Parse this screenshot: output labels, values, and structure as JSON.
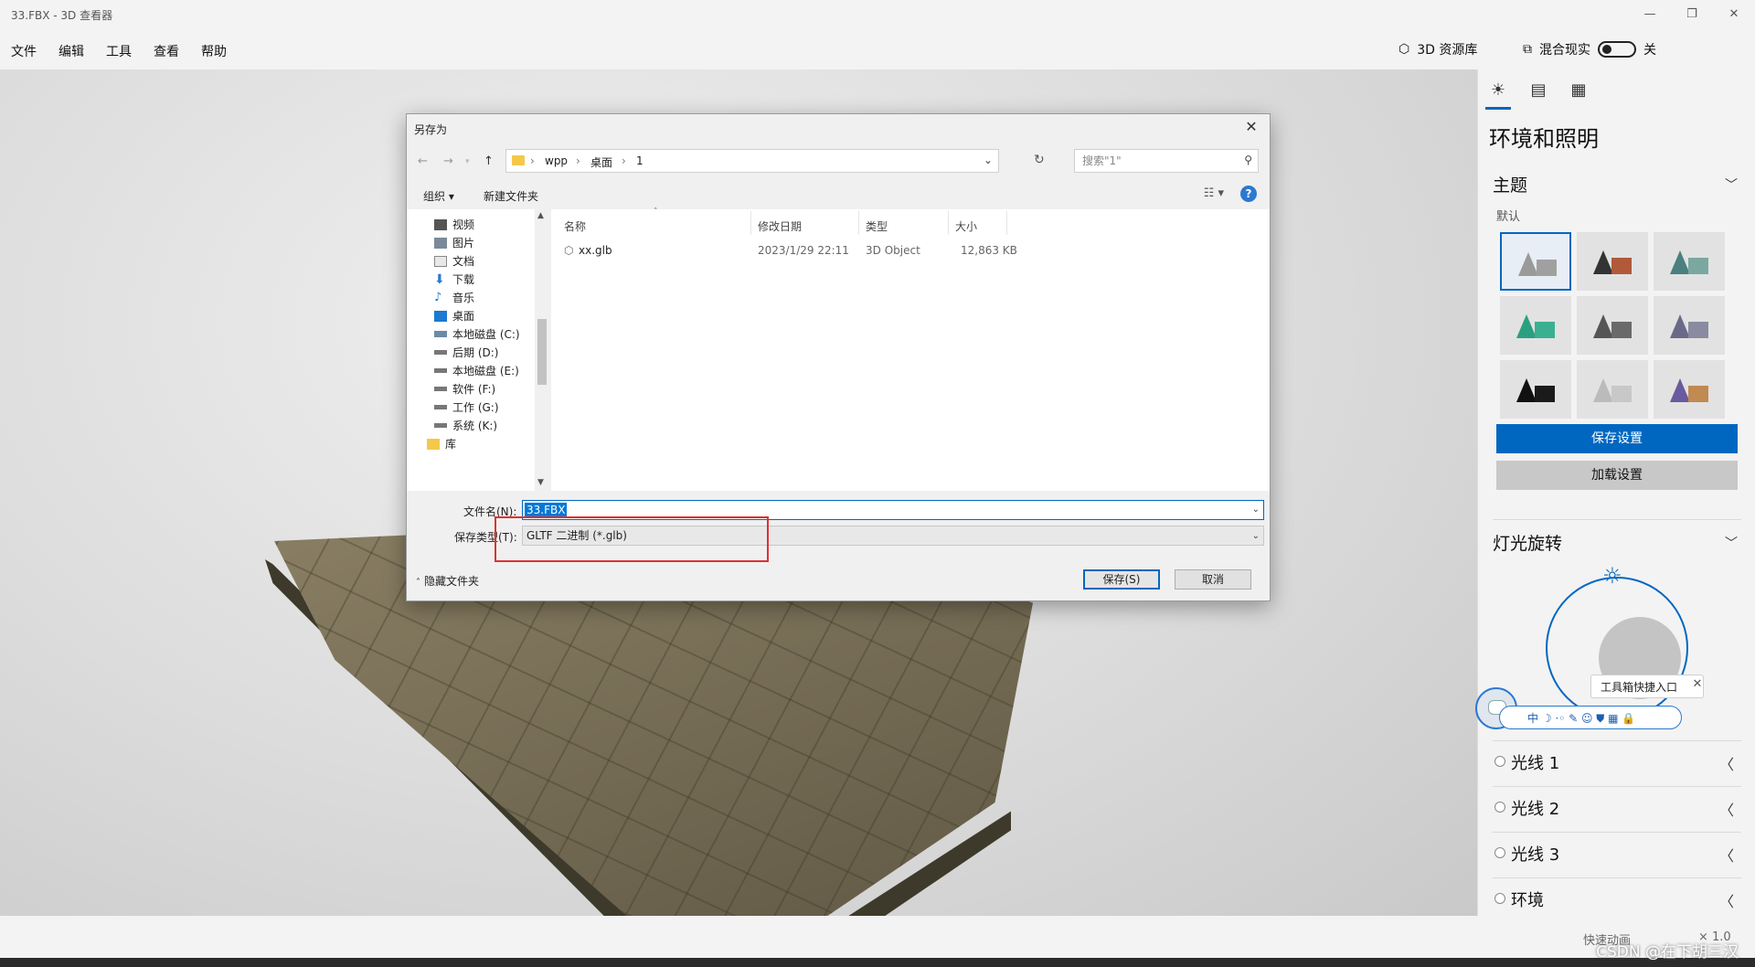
{
  "app": {
    "title": "33.FBX - 3D 查看器"
  },
  "window_controls": {
    "minimize": "—",
    "restore": "❐",
    "close": "✕"
  },
  "menu": [
    "文件",
    "编辑",
    "工具",
    "查看",
    "帮助"
  ],
  "top_right": {
    "library_label": "3D 资源库",
    "mixed_reality_label": "混合现实",
    "toggle_state": "关"
  },
  "panel": {
    "tabs": [
      {
        "icon": "sun-icon",
        "glyph": "☀"
      },
      {
        "icon": "stats-icon",
        "glyph": "▤"
      },
      {
        "icon": "grid-icon",
        "glyph": "▦"
      }
    ],
    "title": "环境和照明",
    "theme": {
      "title": "主题",
      "subtitle": "默认",
      "save_label": "保存设置",
      "load_label": "加载设置"
    },
    "light_rotation": {
      "title": "灯光旋转"
    },
    "lights": [
      "光线 1",
      "光线 2",
      "光线 3",
      "环境"
    ]
  },
  "helper": {
    "popup_label": "工具箱快捷入口",
    "close": "✕",
    "bar_glyphs": "中 ☽ ·◦ ✎ ☺ ⛊ ▦ 🔒"
  },
  "bottom": {
    "quick_anim": "快速动画",
    "speed": "× 1.0"
  },
  "watermark": "CSDN @在下胡三汉",
  "dialog": {
    "title": "另存为",
    "close": "✕",
    "nav": {
      "back": "←",
      "forward": "→",
      "up": "↑",
      "refresh": "↻"
    },
    "breadcrumb": [
      "wpp",
      "桌面",
      "1"
    ],
    "search_placeholder": "搜索\"1\"",
    "commands": {
      "organize": "组织 ▾",
      "new_folder": "新建文件夹",
      "help": "?"
    },
    "nav_items": [
      "视频",
      "图片",
      "文档",
      "下载",
      "音乐",
      "桌面",
      "本地磁盘 (C:)",
      "后期 (D:)",
      "本地磁盘 (E:)",
      "软件 (F:)",
      "工作 (G:)",
      "系统 (K:)",
      "库"
    ],
    "columns": [
      "名称",
      "修改日期",
      "类型",
      "大小"
    ],
    "files": [
      {
        "name": "xx.glb",
        "date": "2023/1/29 22:11",
        "type": "3D Object",
        "size": "12,863 KB"
      }
    ],
    "filename_label": "文件名(N):",
    "filename_value": "33.FBX",
    "filetype_label": "保存类型(T):",
    "filetype_value": "GLTF 二进制 (*.glb)",
    "hide_folders": "隐藏文件夹",
    "save": "保存(S)",
    "cancel": "取消"
  },
  "colors": {
    "accent": "#0067c0",
    "highlight_box": "#e03030"
  }
}
